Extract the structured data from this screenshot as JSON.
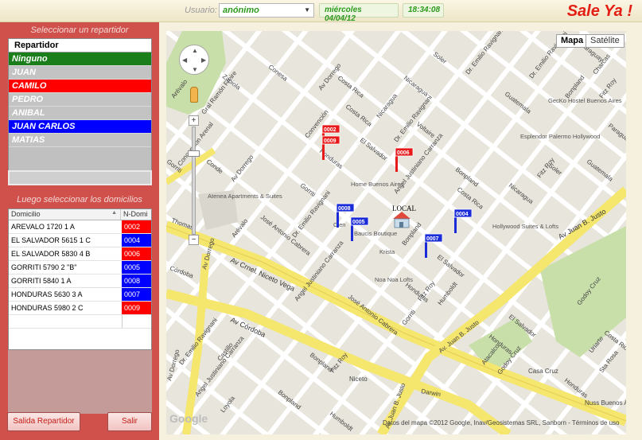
{
  "header": {
    "user_label": "Usuario:",
    "user_value": "anónimo",
    "date": "miércoles 04/04/12",
    "time": "18:34:08",
    "brand": "Sale Ya !"
  },
  "left_panel": {
    "repartidor_title": "Seleccionar un repartidor",
    "repartidor_header": "Repartidor",
    "repartidores": [
      {
        "label": "Ninguno",
        "color": "#1a7e1a"
      },
      {
        "label": "JUAN",
        "color": "#c3c3c3"
      },
      {
        "label": "CAMILO",
        "color": "#ff0000"
      },
      {
        "label": "PEDRO",
        "color": "#c3c3c3"
      },
      {
        "label": "ANIBAL",
        "color": "#c3c3c3"
      },
      {
        "label": "JUAN CARLOS",
        "color": "#0000ff"
      },
      {
        "label": "MATIAS",
        "color": "#c3c3c3"
      }
    ],
    "domicilios_title": "Luego seleccionar los domicilios",
    "table_headers": {
      "domicilio": "Domicilio",
      "ndomi": "N-Domi"
    },
    "domicilios": [
      {
        "address": "AREVALO 1720 1 A",
        "num": "0002",
        "color": "#ff0000"
      },
      {
        "address": "EL SALVADOR 5615 1 C",
        "num": "0004",
        "color": "#0000ff"
      },
      {
        "address": "EL SALVADOR 5830 4 B",
        "num": "0006",
        "color": "#ff0000"
      },
      {
        "address": "GORRITI 5790 2 \"B\"",
        "num": "0005",
        "color": "#0000ff"
      },
      {
        "address": "GORRITI 5840 1 A",
        "num": "0008",
        "color": "#0000ff"
      },
      {
        "address": "HONDURAS 5630 3 A",
        "num": "0007",
        "color": "#0000ff"
      },
      {
        "address": "HONDURAS 5980 2 C",
        "num": "0009",
        "color": "#ff0000"
      }
    ],
    "btn_salida": "Salida Repartidor",
    "btn_salir": "Salir"
  },
  "map": {
    "type_map": "Mapa",
    "type_sat": "Satélite",
    "local_label": "LOCAL",
    "attribution": "Datos del mapa ©2012 Google, Inav/Geosistemas SRL, Sanborn - Términos de uso",
    "google_logo": "Google",
    "streets": {
      "conesa": "Conesa",
      "zapiola": "Zapiola",
      "av_dorrego_top": "Av Dorrego",
      "costa_rica": "Costa Rica",
      "nicaragua": "Nicaragua",
      "soler": "Soler",
      "dr_emilio_ravignani_top": "Dr. Emilio Ravignani",
      "paraguay": "Paraguay",
      "charcas": "Charcas",
      "fitz_roy_top": "Fitz Roy",
      "bonpland_top": "Bonpland",
      "guatemala_top": "Guatemala",
      "arevalo_top": "Arévalo",
      "convencion": "Convención",
      "gral_ramon_freire": "Gral Ramón Freire",
      "el_salvador_top": "El Salvador",
      "voltaire": "Voltaire",
      "angel_carranza": "Angel Justiniano Carranza",
      "honduras": "Honduras",
      "concepcion_arenal": "Concepción Arenal",
      "conde": "Conde",
      "av_dorrego_left": "Av Dorrego",
      "gorriti": "Gorriti",
      "dr_emilio_ravignani_mid": "Dr. Emilio Ravignani",
      "jose_antonio_cabrera": "José Antonio Cabrera",
      "bonpland_mid": "Bonpland",
      "costa_rica_mid": "Costa Rica",
      "fitz_roy_mid": "Fitz Roy",
      "nicaragua_mid": "Nicaragua",
      "soler_mid": "Soler",
      "guatemala_mid": "Guatemala",
      "av_juan_b_justo": "Av Juan B. Justo",
      "thomas": "Thomas",
      "cordoba_left": "Córdoba",
      "av_dorrego_bottom": "Av Dorrego",
      "av_crnel_niceto_vega": "Av Crnel. Niceto Vega",
      "av_cordoba": "Av Córdoba",
      "arevalo_mid": "Arévalo",
      "angel_carranza_mid": "Angel Justiniano Carranza",
      "el_salvador_mid": "El Salvador",
      "jose_antonio_cabrera_mid": "José Antonio Cabrera",
      "honduras_mid": "Honduras",
      "humboldt": "Humboldt",
      "gorriti_mid": "Gorriti",
      "av_juan_b_justo_mid": "Av. Juan B. Justo",
      "fitz_roy_bottom": "Fitz Roy",
      "godoy_cruz": "Godoy Cruz",
      "casa_cruz": "Casa Cruz",
      "uriarte": "Uriarte",
      "costa_rica_bottom": "Costa Rica",
      "honduras_bottom": "Honduras",
      "dr_ravignani_bottom": "Dr. Emilio Ravignani",
      "castillo": "Castillo",
      "angel_carranza_bottom": "Angel Justiniano Carranza",
      "loyola": "Loyola",
      "av_dorrego_b2": "Av Dorrego",
      "bonpland_bottom": "Bonpland",
      "niceto": "Niceto",
      "av_juan_b_justo_b": "Av Juan B. Justo",
      "darwin": "Darwin",
      "humboldt_bottom": "Humboldt",
      "atacalco": "Atacalco",
      "santa_rosa": "Sta Rosa",
      "gurruchaga": "Gurruchaga",
      "nuss_buenos": "Nuss Buenos Aires"
    },
    "pois": {
      "geckho": "GecKo Hostel Buenos Aires",
      "esplendor": "Esplendor Palermo Hollywood",
      "home_ba": "Home Buenos Aires",
      "atenea": "Atenea Apartments & Suites",
      "hollywood_suites": "Hollywood Suites & Lofts",
      "baucis": "Baucis Boutique",
      "krista": "Krista",
      "noa_noa": "Noa Noa Lofts",
      "cien": "Cien"
    },
    "markers": [
      {
        "label": "0002",
        "color": "#e8191a"
      },
      {
        "label": "0009",
        "color": "#e8191a"
      },
      {
        "label": "0006",
        "color": "#e8191a"
      },
      {
        "label": "0008",
        "color": "#1a2bd8"
      },
      {
        "label": "0005",
        "color": "#1a2bd8"
      },
      {
        "label": "0004",
        "color": "#1a2bd8"
      },
      {
        "label": "0007",
        "color": "#1a2bd8"
      }
    ]
  }
}
